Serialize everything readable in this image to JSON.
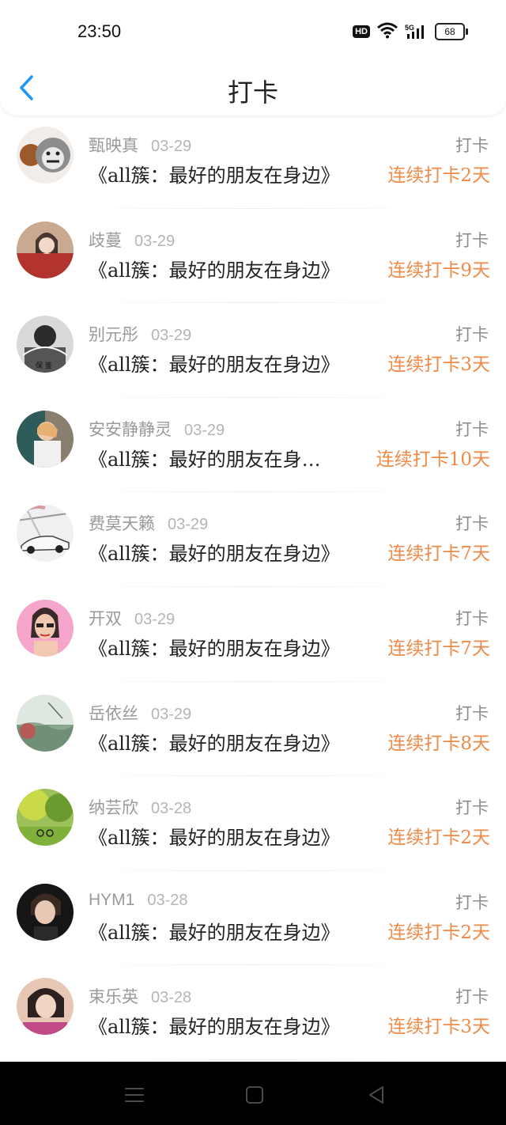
{
  "status": {
    "time": "23:50",
    "hd": "HD",
    "network": "5G",
    "battery": "68"
  },
  "header": {
    "title": "打卡"
  },
  "rows": [
    {
      "name": "甄映真",
      "date": "03-29",
      "action": "打卡",
      "book": "《all簇：最好的朋友在身边》",
      "streak": "连续打卡2天"
    },
    {
      "name": "歧蔓",
      "date": "03-29",
      "action": "打卡",
      "book": "《all簇：最好的朋友在身边》",
      "streak": "连续打卡9天"
    },
    {
      "name": "别元彤",
      "date": "03-29",
      "action": "打卡",
      "book": "《all簇：最好的朋友在身边》",
      "streak": "连续打卡3天"
    },
    {
      "name": "安安静静灵",
      "date": "03-29",
      "action": "打卡",
      "book": "《all簇：最好的朋友在身…",
      "streak": "连续打卡10天"
    },
    {
      "name": "费莫天籁",
      "date": "03-29",
      "action": "打卡",
      "book": "《all簇：最好的朋友在身边》",
      "streak": "连续打卡7天"
    },
    {
      "name": "开双",
      "date": "03-29",
      "action": "打卡",
      "book": "《all簇：最好的朋友在身边》",
      "streak": "连续打卡7天"
    },
    {
      "name": "岳依丝",
      "date": "03-29",
      "action": "打卡",
      "book": "《all簇：最好的朋友在身边》",
      "streak": "连续打卡8天"
    },
    {
      "name": "纳芸欣",
      "date": "03-28",
      "action": "打卡",
      "book": "《all簇：最好的朋友在身边》",
      "streak": "连续打卡2天"
    },
    {
      "name": "HYM1",
      "date": "03-28",
      "action": "打卡",
      "book": "《all簇：最好的朋友在身边》",
      "streak": "连续打卡2天"
    },
    {
      "name": "束乐英",
      "date": "03-28",
      "action": "打卡",
      "book": "《all簇：最好的朋友在身边》",
      "streak": "连续打卡3天"
    }
  ],
  "colors": {
    "accent": "#2196f3",
    "streak": "#ef8a47",
    "muted": "#9a9a9a"
  },
  "icons": {
    "back": "chevron-left-icon",
    "menu": "menu-icon",
    "home": "home-square-icon",
    "nav_back": "triangle-back-icon"
  }
}
